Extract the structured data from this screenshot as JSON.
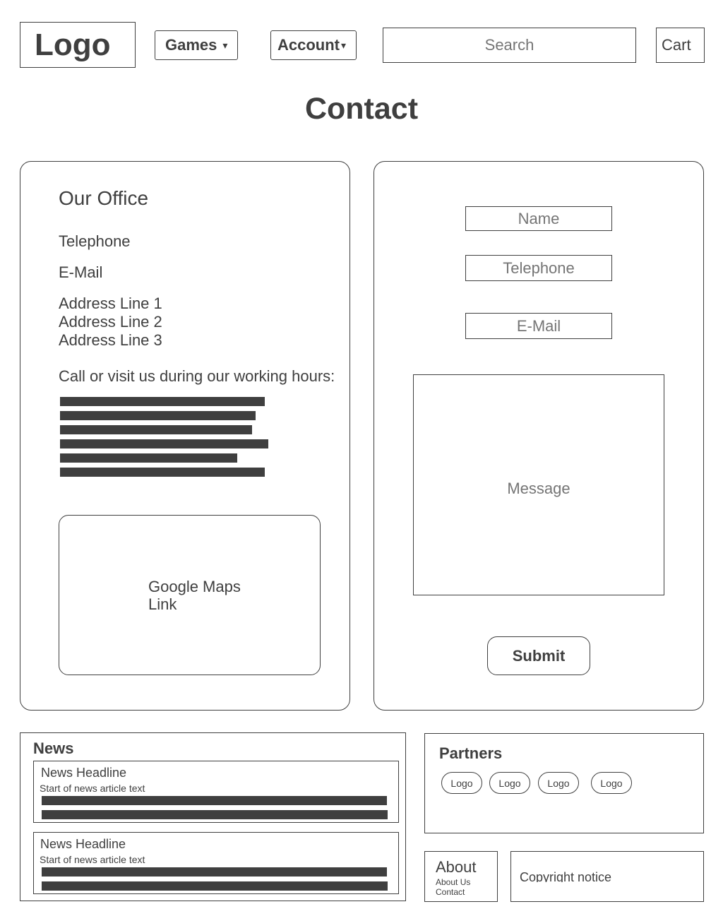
{
  "header": {
    "logo": "Logo",
    "games": "Games",
    "account": "Account",
    "caret": "▾",
    "search_placeholder": "Search",
    "cart": "Cart"
  },
  "page": {
    "title": "Contact"
  },
  "office": {
    "title": "Our Office",
    "telephone": "Telephone",
    "email": "E-Mail",
    "address": [
      "Address Line 1",
      "Address Line 2",
      "Address Line 3"
    ],
    "hours_intro": "Call or visit us during our working hours:",
    "map_label": "Google Maps Link"
  },
  "form": {
    "name_placeholder": "Name",
    "telephone_placeholder": "Telephone",
    "email_placeholder": "E-Mail",
    "message_placeholder": "Message",
    "submit": "Submit"
  },
  "news": {
    "title": "News",
    "items": [
      {
        "headline": "News Headline",
        "text": "Start of news article text"
      },
      {
        "headline": "News Headline",
        "text": "Start of news article text"
      }
    ]
  },
  "partners": {
    "title": "Partners",
    "logos": [
      "Logo",
      "Logo",
      "Logo",
      "Logo"
    ]
  },
  "about": {
    "title": "About",
    "links": [
      "About Us",
      "Contact"
    ]
  },
  "copyright": "Copyright notice"
}
